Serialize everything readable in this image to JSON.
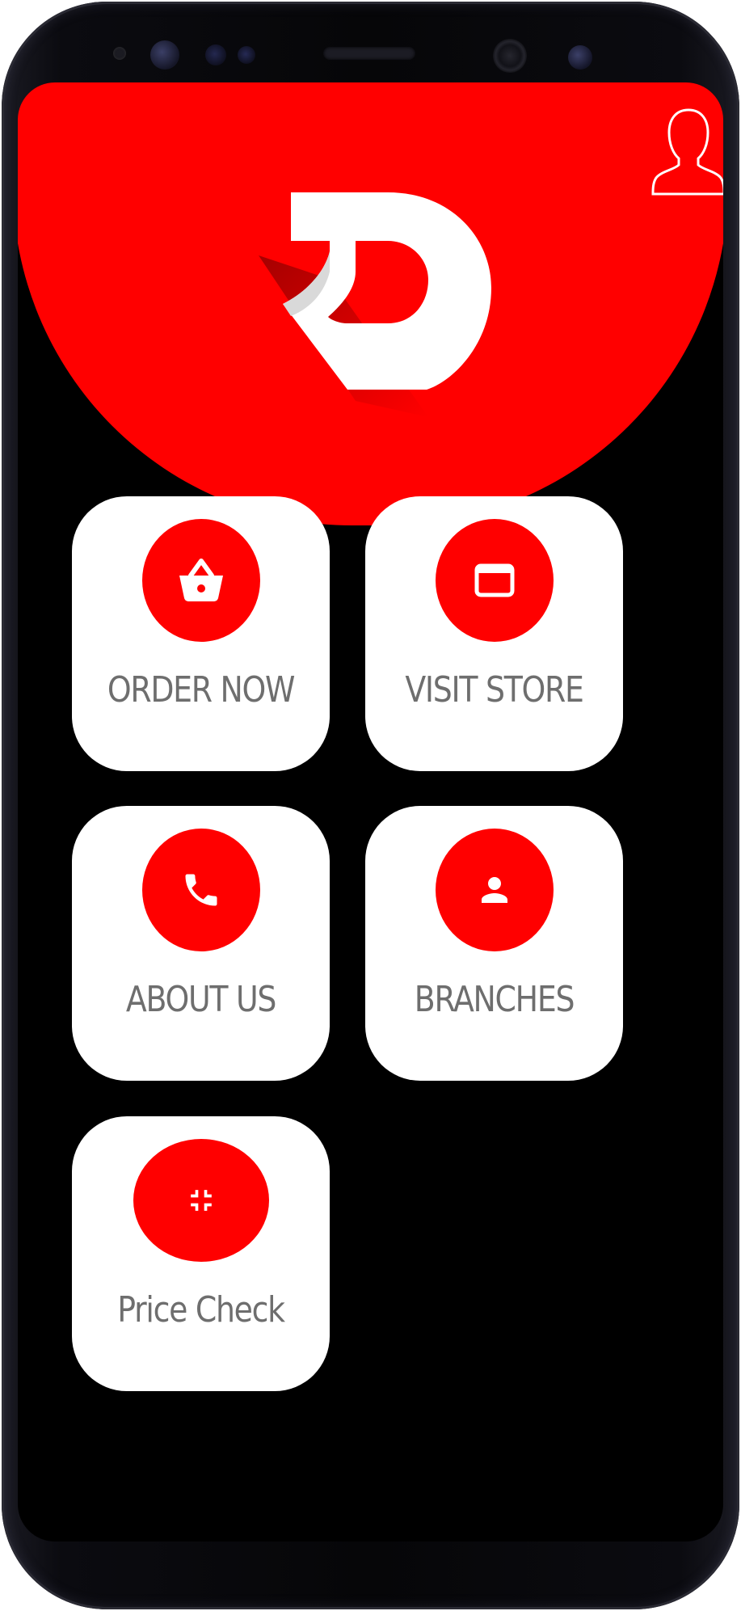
{
  "header": {
    "brand_color": "#ff0000",
    "logo_icon": "d-logo-icon",
    "profile_icon": "user-profile-icon"
  },
  "tiles": [
    {
      "label": "ORDER NOW",
      "icon": "shopping-basket-icon"
    },
    {
      "label": "VISIT STORE",
      "icon": "web-window-icon"
    },
    {
      "label": "ABOUT US",
      "icon": "phone-icon"
    },
    {
      "label": "BRANCHES",
      "icon": "person-icon"
    },
    {
      "label": "Price Check",
      "icon": "collapse-arrows-icon"
    }
  ],
  "colors": {
    "tile_background": "#ffffff",
    "tile_label": "#6e6e6e",
    "screen_background": "#000000",
    "icon_circle": "#ff0000"
  }
}
